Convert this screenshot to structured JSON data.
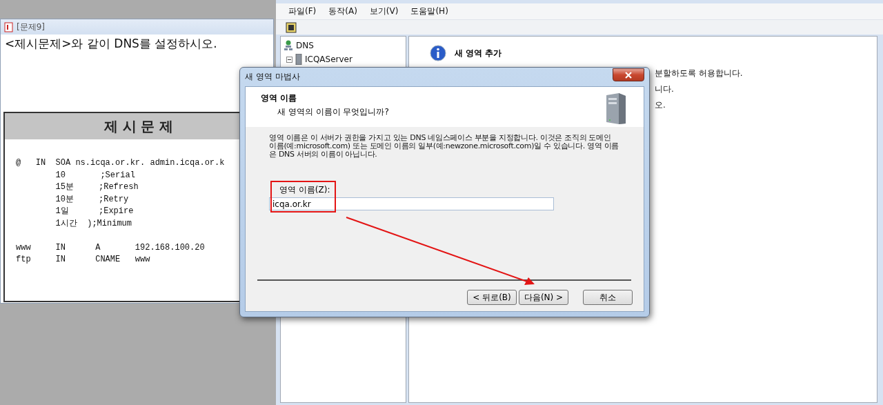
{
  "question_window": {
    "title": "[문제9]",
    "instruction": "<제시문제>와 같이 DNS를 설정하시오.",
    "problem": {
      "heading": "제 시 문 제",
      "soa_lines": [
        "@   IN  SOA ns.icqa.or.kr. admin.icqa.or.k",
        "        10       ;Serial",
        "        15분     ;Refresh",
        "        10분     ;Retry",
        "        1일      ;Expire",
        "        1시간  );Minimum"
      ],
      "records": [
        "www     IN      A       192.168.100.20",
        "ftp     IN      CNAME   www"
      ]
    }
  },
  "mmc_window": {
    "menu": [
      "파일(F)",
      "동작(A)",
      "보기(V)",
      "도움말(H)"
    ],
    "tree": [
      {
        "label": "DNS",
        "kind": "dns",
        "children": [
          {
            "label": "ICQAServer",
            "kind": "server",
            "expanded": true
          }
        ]
      }
    ],
    "details": {
      "heading": "새 영역 추가",
      "lines": [
        "분할하도록 허용합니다.",
        "니다.",
        "오."
      ]
    }
  },
  "dialog": {
    "title": "새 영역 마법사",
    "header_title": "영역 이름",
    "header_subtitle": "새 영역의 이름이 무엇입니까?",
    "description": "영역 이름은 이 서버가 권한을 가지고 있는 DNS 네임스페이스 부분을 지정합니다. 이것은 조직의 도메인 이름(예:microsoft.com) 또는 도메인 이름의 일부(예:newzone.microsoft.com)일 수 있습니다. 영역 이름은 DNS 서버의 이름이 아닙니다.",
    "field": {
      "label": "영역 이름(Z):",
      "value": "icqa.or.kr"
    },
    "buttons": [
      {
        "label": "< 뒤로(B)",
        "kind": "nav"
      },
      {
        "label": "다음(N) >",
        "kind": "nav"
      },
      {
        "label": "취소",
        "kind": "cancel"
      }
    ]
  }
}
